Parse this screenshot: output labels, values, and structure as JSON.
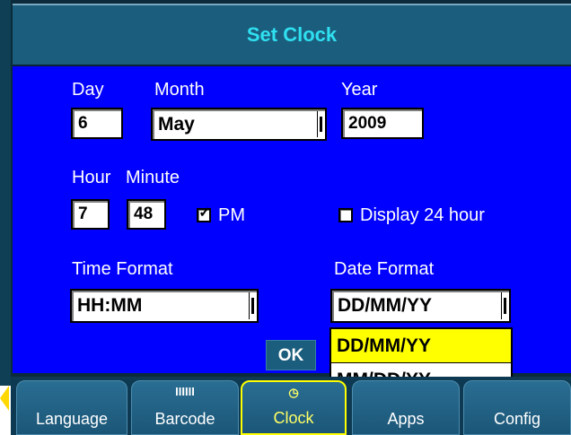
{
  "window": {
    "title": "Set Clock"
  },
  "date": {
    "day_label": "Day",
    "day_value": "6",
    "month_label": "Month",
    "month_value": "May",
    "year_label": "Year",
    "year_value": "2009"
  },
  "time": {
    "hour_label": "Hour",
    "hour_value": "7",
    "minute_label": "Minute",
    "minute_value": "48",
    "pm_label": "PM",
    "pm_checked": true,
    "display24_label": "Display 24 hour",
    "display24_checked": false
  },
  "formats": {
    "time_format_label": "Time Format",
    "time_format_value": "HH:MM",
    "date_format_label": "Date Format",
    "date_format_value": "DD/MM/YY",
    "date_format_options": [
      "DD/MM/YY",
      "MM/DD/YY"
    ]
  },
  "ok_label": "OK",
  "tabs": [
    {
      "label": "Language",
      "icon": "",
      "active": false
    },
    {
      "label": "Barcode",
      "icon": "barcode-icon",
      "icon_glyph": "IIIIII",
      "active": false
    },
    {
      "label": "Clock",
      "icon": "clock-icon",
      "icon_glyph": "◷",
      "active": true
    },
    {
      "label": "Apps",
      "icon": "",
      "active": false
    },
    {
      "label": "Config",
      "icon": "",
      "active": false
    }
  ],
  "colors": {
    "panel": "#0000ff",
    "title_text": "#2fe0f0",
    "highlight": "#ffff00",
    "tab_bg": "#1b5d7d"
  }
}
